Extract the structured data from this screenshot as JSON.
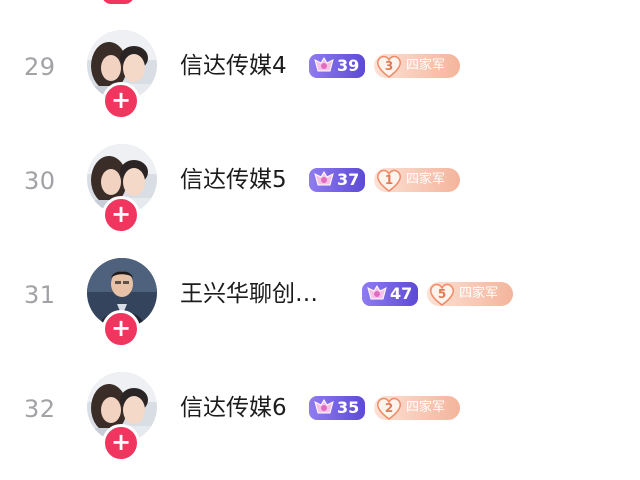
{
  "rows": [
    {
      "rank": "29",
      "name": "信达传媒4",
      "level": "39",
      "fan_level": "3",
      "fan_club": "四家军",
      "avatar": "couple-photo"
    },
    {
      "rank": "30",
      "name": "信达传媒5",
      "level": "37",
      "fan_level": "1",
      "fan_club": "四家军",
      "avatar": "couple-photo"
    },
    {
      "rank": "31",
      "name": "王兴华聊创…",
      "level": "47",
      "fan_level": "5",
      "fan_club": "四家军",
      "avatar": "man-portrait"
    },
    {
      "rank": "32",
      "name": "信达传媒6",
      "level": "35",
      "fan_level": "2",
      "fan_club": "四家军",
      "avatar": "couple-photo"
    }
  ],
  "follow_symbol": "+",
  "colors": {
    "follow_button": "#f0365e",
    "level_badge": "#6b57e0",
    "fan_badge": "#f4b49b",
    "rank_text": "#a2a2a6"
  }
}
